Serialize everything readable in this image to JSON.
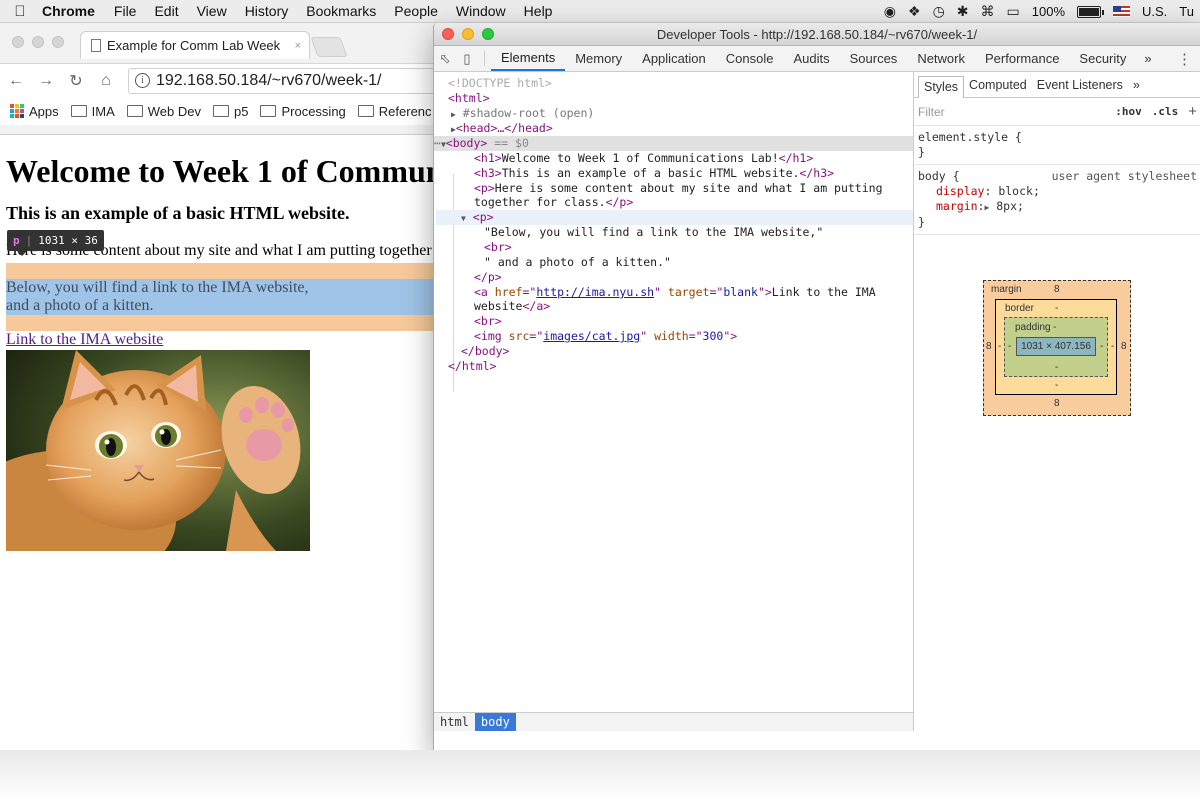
{
  "menubar": {
    "app_name": "Chrome",
    "items": [
      "File",
      "Edit",
      "View",
      "History",
      "Bookmarks",
      "People",
      "Window",
      "Help"
    ],
    "battery": "100%",
    "battery_level": 1.0,
    "input_source": "U.S.",
    "clock": "Tu",
    "tray_icons": [
      "wechat-icon",
      "dropbox-icon",
      "time-machine-icon",
      "bluetooth-icon",
      "wifi-icon",
      "airplay-icon",
      "battery-icon",
      "flag-icon"
    ]
  },
  "chrome": {
    "tab_title": "Example for Comm Lab Week",
    "tab_close": "×",
    "url": "192.168.50.184/~rv670/week-1/",
    "bookmarks": [
      "Apps",
      "IMA",
      "Web Dev",
      "p5",
      "Processing",
      "Referenc"
    ]
  },
  "page": {
    "h1": "Welcome to Week 1 of Communications Lab!",
    "h3": "This is an example of a basic HTML website.",
    "p1": "Here is some content about my site and what I am putting together for class.",
    "p2_line1": "Below, you will find a link to the IMA website,",
    "p2_line2": "and a photo of a kitten.",
    "link": "Link to the IMA website",
    "tooltip_tag": "p",
    "tooltip_size": "1031 × 36"
  },
  "devtools": {
    "window_title": "Developer Tools - http://192.168.50.184/~rv670/week-1/",
    "tabs": [
      "Elements",
      "Memory",
      "Application",
      "Console",
      "Audits",
      "Sources",
      "Network",
      "Performance",
      "Security"
    ],
    "active_tab": "Elements",
    "more": "»",
    "dom": {
      "doctype": "<!DOCTYPE html>",
      "html_open": "<html>",
      "shadow_root": "#shadow-root (open)",
      "head": "<head>…</head>",
      "body_open": "<body>",
      "body_marker": "== $0",
      "h1_text": "Welcome to Week 1 of Communications Lab!",
      "h3_text": "This is an example of a basic HTML website.",
      "p1_text_a": "Here is some content about my site and what I am putting",
      "p1_text_b": "together for class.",
      "p2_text_a": "\"Below, you will find a link to the IMA website,\"",
      "p2_text_b": "\" and a photo of a kitten.\"",
      "a_href": "http://ima.nyu.sh",
      "a_target": "blank",
      "a_text_a": "Link to the IMA",
      "a_text_b": "website",
      "img_src": "images/cat.jpg",
      "img_width": "300",
      "body_close": "</body>",
      "html_close": "</html>"
    },
    "breadcrumbs": [
      "html",
      "body"
    ],
    "styles": {
      "tabs": [
        "Styles",
        "Computed",
        "Event Listeners"
      ],
      "filter_placeholder": "Filter",
      "hov": ":hov",
      "cls": ".cls",
      "element_style": "element.style {",
      "rule_selector": "body {",
      "rule_source": "user agent stylesheet",
      "display_prop": "display",
      "display_val": "block;",
      "margin_prop": "margin",
      "margin_val": "8px;",
      "close_brace": "}"
    },
    "box_model": {
      "margin_label": "margin",
      "margin_value": "8",
      "border_label": "border",
      "padding_label": "padding",
      "dash": "-",
      "content_size": "1031 × 407.156"
    }
  },
  "colors": {
    "margin_overlay": "#f6c89a",
    "content_overlay": "#9fc4e7",
    "active_tab_accent": "#1a73e8"
  }
}
